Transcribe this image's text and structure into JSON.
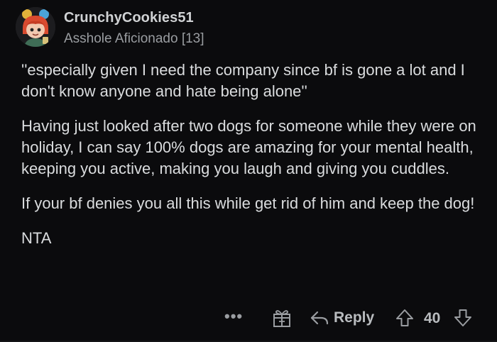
{
  "comment": {
    "username": "CrunchyCookies51",
    "flair": "Asshole Aficionado [13]",
    "paragraphs": [
      "''especially given I need the company since bf is gone a lot and I don't know anyone and hate being alone''",
      "Having just looked after two dogs for someone while they were on holiday, I can say 100% dogs are amazing for your mental health, keeping you active, making you laugh and giving you cuddles.",
      "If your bf denies you all this while get rid of him and keep the dog!",
      "NTA"
    ]
  },
  "actions": {
    "more_label": "•••",
    "reply_label": "Reply",
    "score": "40"
  },
  "icons": {
    "avatar": "avatar-icon",
    "more": "more-options-icon",
    "award": "gift-icon",
    "reply": "reply-arrow-icon",
    "upvote": "upvote-arrow-icon",
    "downvote": "downvote-arrow-icon"
  },
  "colors": {
    "background": "#0b0b0d",
    "text": "#dadcde",
    "muted": "#9a9da1",
    "avatar_hair": "#d94a2f",
    "avatar_accent": "#3f6d56"
  }
}
